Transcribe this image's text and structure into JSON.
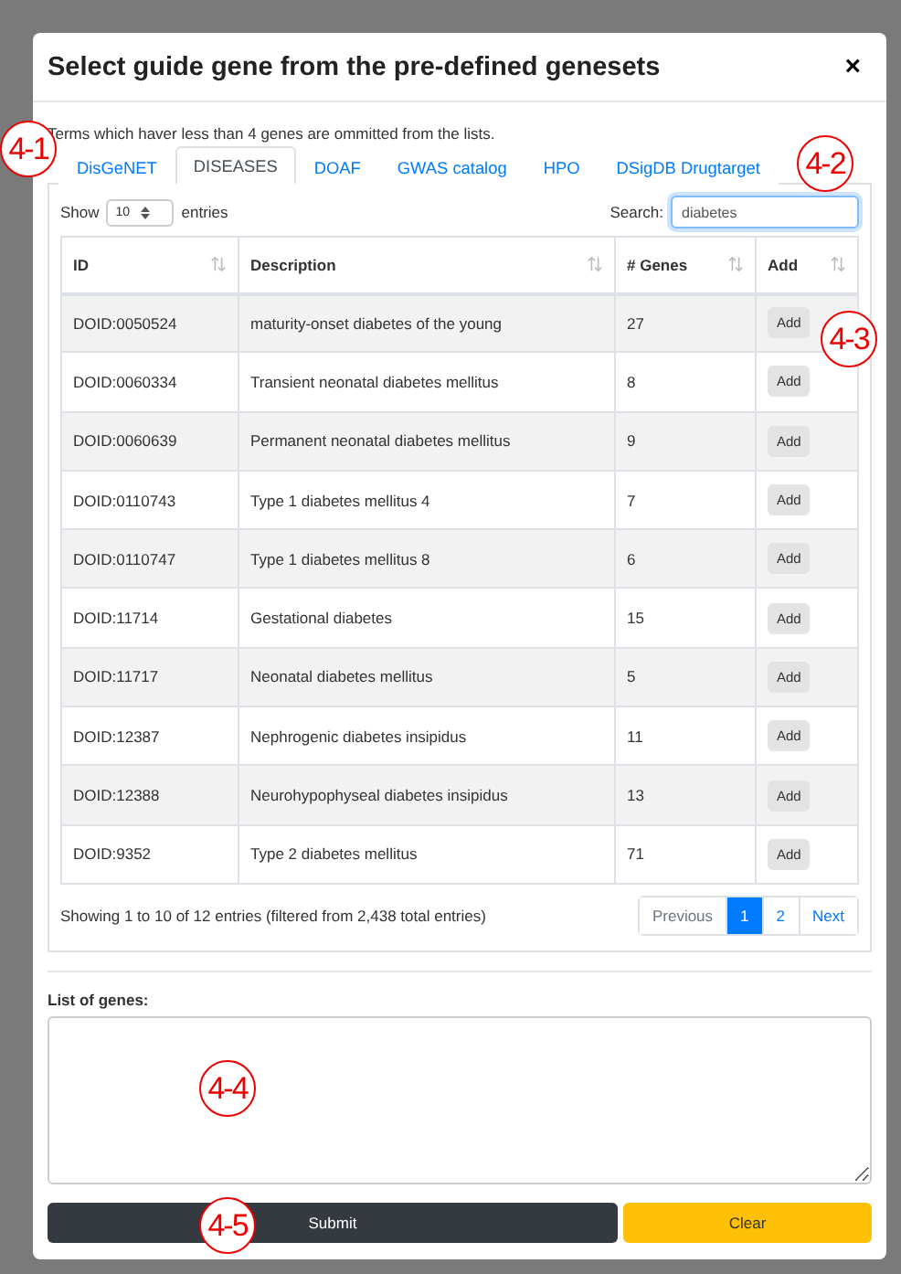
{
  "dialog": {
    "title": "Select guide gene from the pre-defined genesets",
    "close": "×"
  },
  "note": "Terms which haver less than 4 genes are ommitted from the lists.",
  "tabs": [
    {
      "label": "DisGeNET",
      "selected": false
    },
    {
      "label": "DISEASES",
      "selected": true
    },
    {
      "label": "DOAF",
      "selected": false
    },
    {
      "label": "GWAS catalog",
      "selected": false
    },
    {
      "label": "HPO",
      "selected": false
    },
    {
      "label": "DSigDB Drugtarget",
      "selected": false
    }
  ],
  "length": {
    "before": "Show",
    "value": "10",
    "after": "entries"
  },
  "search": {
    "label": "Search:",
    "value": "diabetes"
  },
  "table": {
    "columns": [
      "ID",
      "Description",
      "# Genes",
      "Add"
    ],
    "rows": [
      {
        "id": "DOID:0050524",
        "description": "maturity-onset diabetes of the young",
        "genes": "27",
        "action": "Add"
      },
      {
        "id": "DOID:0060334",
        "description": "Transient neonatal diabetes mellitus",
        "genes": "8",
        "action": "Add"
      },
      {
        "id": "DOID:0060639",
        "description": "Permanent neonatal diabetes mellitus",
        "genes": "9",
        "action": "Add"
      },
      {
        "id": "DOID:0110743",
        "description": "Type 1 diabetes mellitus 4",
        "genes": "7",
        "action": "Add"
      },
      {
        "id": "DOID:0110747",
        "description": "Type 1 diabetes mellitus 8",
        "genes": "6",
        "action": "Add"
      },
      {
        "id": "DOID:11714",
        "description": "Gestational diabetes",
        "genes": "15",
        "action": "Add"
      },
      {
        "id": "DOID:11717",
        "description": "Neonatal diabetes mellitus",
        "genes": "5",
        "action": "Add"
      },
      {
        "id": "DOID:12387",
        "description": "Nephrogenic diabetes insipidus",
        "genes": "11",
        "action": "Add"
      },
      {
        "id": "DOID:12388",
        "description": "Neurohypophyseal diabetes insipidus",
        "genes": "13",
        "action": "Add"
      },
      {
        "id": "DOID:9352",
        "description": "Type 2 diabetes mellitus",
        "genes": "71",
        "action": "Add"
      }
    ]
  },
  "info": "Showing 1 to 10 of 12 entries (filtered from 2,438 total entries)",
  "pagination": [
    {
      "label": "Previous",
      "kind": "nav",
      "selected": false
    },
    {
      "label": "1",
      "kind": "page",
      "selected": true
    },
    {
      "label": "2",
      "kind": "page",
      "selected": false
    },
    {
      "label": "Next",
      "kind": "nav",
      "selected": false
    }
  ],
  "genes_label": "List of genes:",
  "buttons": [
    {
      "label": "Submit",
      "kind": "dark"
    },
    {
      "label": "Clear",
      "kind": "warning"
    }
  ],
  "callouts": [
    "4-1",
    "4-2",
    "4-3",
    "4-4",
    "4-5"
  ]
}
